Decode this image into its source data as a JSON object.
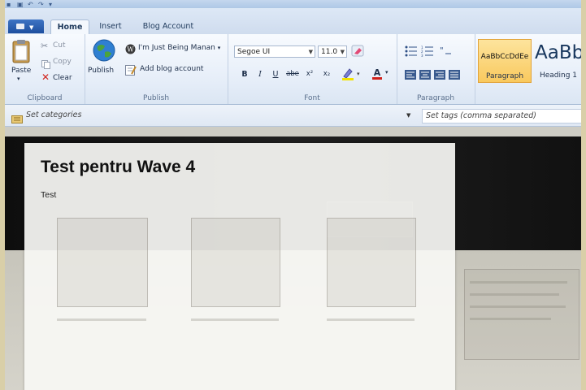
{
  "tabs": [
    "Home",
    "Insert",
    "Blog Account"
  ],
  "clipboard": {
    "paste": "Paste",
    "cut": "Cut",
    "copy": "Copy",
    "clear": "Clear",
    "label": "Clipboard"
  },
  "publish": {
    "publish": "Publish",
    "blog_name": "I'm Just Being Manan",
    "add_account": "Add blog account",
    "label": "Publish"
  },
  "font": {
    "family": "Segoe UI",
    "size": "11.0",
    "bold": "B",
    "italic": "I",
    "underline": "U",
    "strike": "abe",
    "superscript": "x²",
    "subscript": "x₂",
    "color_letter": "A",
    "label": "Font"
  },
  "paragraph": {
    "label": "Paragraph"
  },
  "styles": [
    {
      "sample": "AaBbCcDdEe",
      "name": "Paragraph",
      "selected": true
    },
    {
      "sample": "AaBb",
      "name": "Heading 1",
      "selected": false
    }
  ],
  "categories": {
    "placeholder": "Set categories",
    "tags_placeholder": "Set tags (comma separated)"
  },
  "post": {
    "title": "Test pentru Wave 4",
    "body": "Test"
  },
  "colors": {
    "ribbon_bg": "#e5edf8",
    "file_tab": "#2a5eb0",
    "style_selected": "#f9c95e"
  }
}
